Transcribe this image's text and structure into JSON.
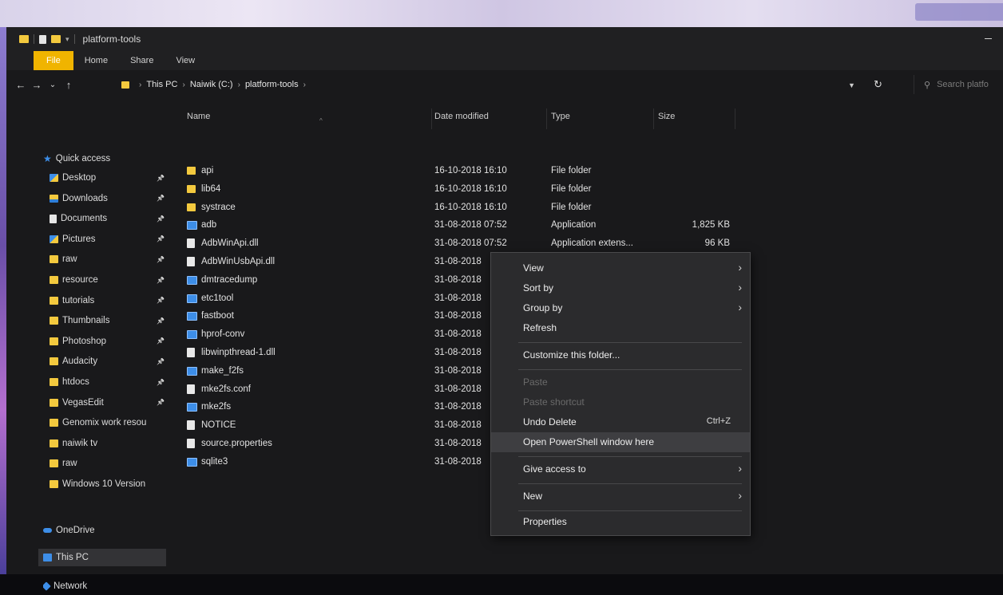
{
  "window": {
    "title": "platform-tools",
    "ribbon_tabs": [
      "File",
      "Home",
      "Share",
      "View"
    ]
  },
  "navigation": {
    "back": "←",
    "forward": "→",
    "recent": "⌄",
    "up": "↑",
    "breadcrumb": [
      "This PC",
      "Naiwik (C:)",
      "platform-tools"
    ],
    "refresh": "↻",
    "search_placeholder": "Search platfo"
  },
  "sidebar": {
    "quick_access": "Quick access",
    "items": [
      {
        "label": "Desktop",
        "pinned": true
      },
      {
        "label": "Downloads",
        "pinned": true
      },
      {
        "label": "Documents",
        "pinned": true
      },
      {
        "label": "Pictures",
        "pinned": true
      },
      {
        "label": "raw",
        "pinned": true
      },
      {
        "label": "resource",
        "pinned": true
      },
      {
        "label": "tutorials",
        "pinned": true
      },
      {
        "label": "Thumbnails",
        "pinned": true
      },
      {
        "label": "Photoshop",
        "pinned": true
      },
      {
        "label": "Audacity",
        "pinned": true
      },
      {
        "label": "htdocs",
        "pinned": true
      },
      {
        "label": "VegasEdit",
        "pinned": true
      },
      {
        "label": "Genomix work resou",
        "pinned": false
      },
      {
        "label": "naiwik tv",
        "pinned": false
      },
      {
        "label": "raw",
        "pinned": false
      },
      {
        "label": "Windows 10 Version",
        "pinned": false
      }
    ],
    "onedrive": "OneDrive",
    "this_pc": "This PC",
    "network": "Network"
  },
  "columns": {
    "name": "Name",
    "date": "Date modified",
    "type": "Type",
    "size": "Size"
  },
  "files": [
    {
      "name": "api",
      "date": "16-10-2018 16:10",
      "type": "File folder",
      "size": "",
      "kind": "folder"
    },
    {
      "name": "lib64",
      "date": "16-10-2018 16:10",
      "type": "File folder",
      "size": "",
      "kind": "folder"
    },
    {
      "name": "systrace",
      "date": "16-10-2018 16:10",
      "type": "File folder",
      "size": "",
      "kind": "folder"
    },
    {
      "name": "adb",
      "date": "31-08-2018 07:52",
      "type": "Application",
      "size": "1,825 KB",
      "kind": "app"
    },
    {
      "name": "AdbWinApi.dll",
      "date": "31-08-2018 07:52",
      "type": "Application extens...",
      "size": "96 KB",
      "kind": "file"
    },
    {
      "name": "AdbWinUsbApi.dll",
      "date": "31-08-2018",
      "type": "",
      "size": "",
      "kind": "file"
    },
    {
      "name": "dmtracedump",
      "date": "31-08-2018",
      "type": "",
      "size": "",
      "kind": "app"
    },
    {
      "name": "etc1tool",
      "date": "31-08-2018",
      "type": "",
      "size": "",
      "kind": "app"
    },
    {
      "name": "fastboot",
      "date": "31-08-2018",
      "type": "",
      "size": "",
      "kind": "app"
    },
    {
      "name": "hprof-conv",
      "date": "31-08-2018",
      "type": "",
      "size": "",
      "kind": "app"
    },
    {
      "name": "libwinpthread-1.dll",
      "date": "31-08-2018",
      "type": "",
      "size": "",
      "kind": "file"
    },
    {
      "name": "make_f2fs",
      "date": "31-08-2018",
      "type": "",
      "size": "",
      "kind": "app"
    },
    {
      "name": "mke2fs.conf",
      "date": "31-08-2018",
      "type": "",
      "size": "",
      "kind": "file"
    },
    {
      "name": "mke2fs",
      "date": "31-08-2018",
      "type": "",
      "size": "",
      "kind": "app"
    },
    {
      "name": "NOTICE",
      "date": "31-08-2018",
      "type": "",
      "size": "",
      "kind": "file"
    },
    {
      "name": "source.properties",
      "date": "31-08-2018",
      "type": "",
      "size": "",
      "kind": "file"
    },
    {
      "name": "sqlite3",
      "date": "31-08-2018",
      "type": "",
      "size": "",
      "kind": "app"
    }
  ],
  "context_menu": {
    "view": "View",
    "sort_by": "Sort by",
    "group_by": "Group by",
    "refresh": "Refresh",
    "customize": "Customize this folder...",
    "paste": "Paste",
    "paste_shortcut": "Paste shortcut",
    "undo_delete": "Undo Delete",
    "undo_shortcut": "Ctrl+Z",
    "open_powershell": "Open PowerShell window here",
    "give_access": "Give access to",
    "new": "New",
    "properties": "Properties",
    "submenu_arrow": "›"
  },
  "colors": {
    "window_bg": "#19191b",
    "menu_bg": "#2b2b2d",
    "folder": "#f3c93e",
    "accent_blue": "#3d8ee8",
    "file_tab": "#f0b400"
  }
}
